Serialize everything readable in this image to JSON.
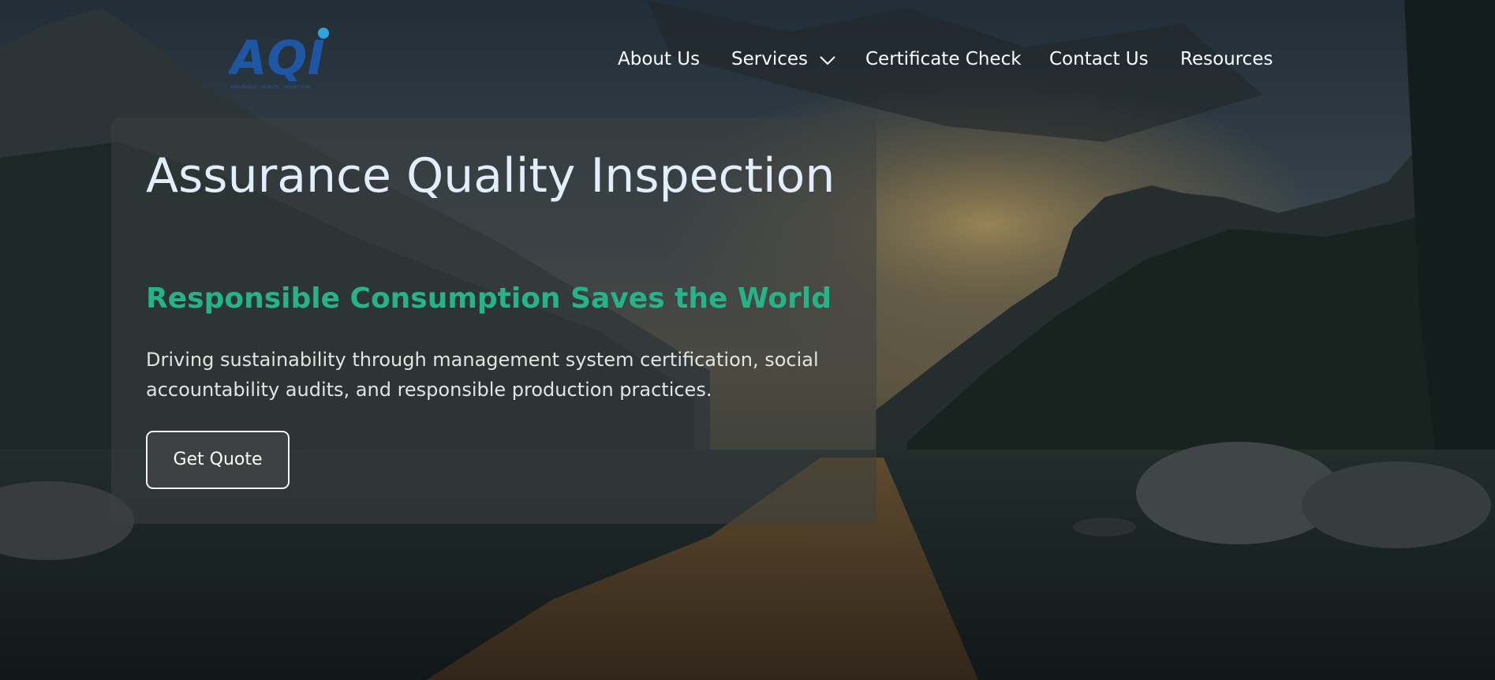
{
  "brand": {
    "name": "AQI",
    "tagline": "ASSURANCE · QUALITY · INSPECTION",
    "primary_color": "#1f56a4",
    "accent_color": "#2ea3e0"
  },
  "nav": {
    "items": [
      {
        "label": "About Us"
      },
      {
        "label": "Services",
        "icon": "chevron-down-icon"
      },
      {
        "label": "Certificate Check"
      },
      {
        "label": "Contact Us"
      },
      {
        "label": "Resources"
      }
    ]
  },
  "hero": {
    "title": "Assurance Quality Inspection",
    "subtitle": "Responsible Consumption Saves the World",
    "description": "Driving sustainability through management system certification, social accountability audits, and responsible production practices.",
    "cta_label": "Get Quote",
    "background": "mountain-lake-sunset-photo"
  },
  "colors": {
    "title": "#e3eefd",
    "subtitle": "#27b38a",
    "body": "#e2e4e4",
    "nav_text": "#ffffff"
  }
}
